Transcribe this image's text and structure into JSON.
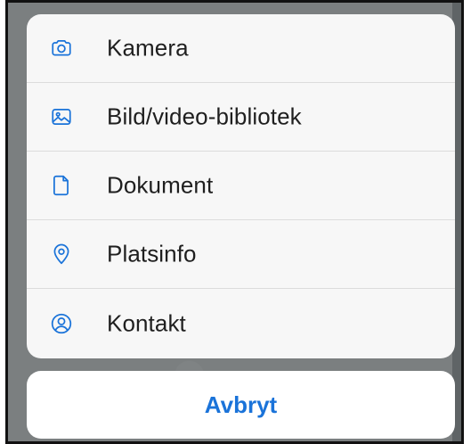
{
  "sheet": {
    "items": [
      {
        "icon": "camera-icon",
        "label": "Kamera"
      },
      {
        "icon": "photo-library-icon",
        "label": "Bild/video-bibliotek"
      },
      {
        "icon": "document-icon",
        "label": "Dokument"
      },
      {
        "icon": "location-pin-icon",
        "label": "Platsinfo"
      },
      {
        "icon": "contact-icon",
        "label": "Kontakt"
      }
    ],
    "cancel_label": "Avbryt"
  },
  "colors": {
    "accent": "#1a73d9",
    "sheet_background": "#f7f7f7",
    "overlay": "#7b7f80",
    "text": "#1f1f1f"
  }
}
